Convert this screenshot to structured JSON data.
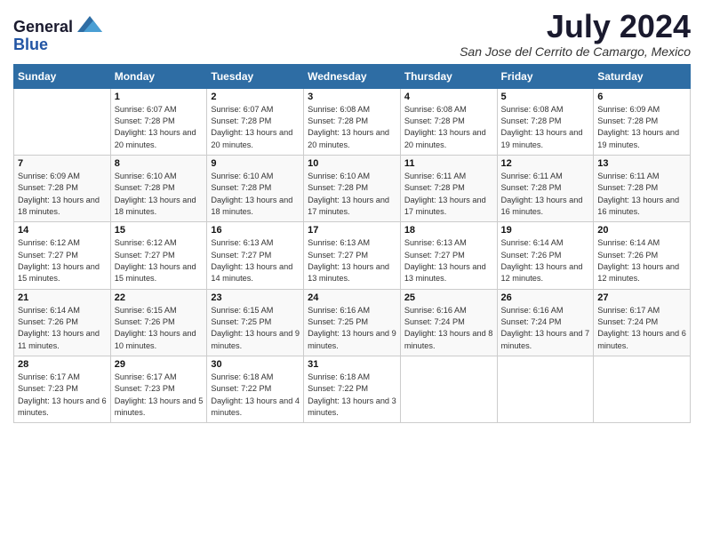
{
  "logo": {
    "general": "General",
    "blue": "Blue"
  },
  "title": "July 2024",
  "subtitle": "San Jose del Cerrito de Camargo, Mexico",
  "weekdays": [
    "Sunday",
    "Monday",
    "Tuesday",
    "Wednesday",
    "Thursday",
    "Friday",
    "Saturday"
  ],
  "weeks": [
    [
      {
        "day": "",
        "sunrise": "",
        "sunset": "",
        "daylight": ""
      },
      {
        "day": "1",
        "sunrise": "Sunrise: 6:07 AM",
        "sunset": "Sunset: 7:28 PM",
        "daylight": "Daylight: 13 hours and 20 minutes."
      },
      {
        "day": "2",
        "sunrise": "Sunrise: 6:07 AM",
        "sunset": "Sunset: 7:28 PM",
        "daylight": "Daylight: 13 hours and 20 minutes."
      },
      {
        "day": "3",
        "sunrise": "Sunrise: 6:08 AM",
        "sunset": "Sunset: 7:28 PM",
        "daylight": "Daylight: 13 hours and 20 minutes."
      },
      {
        "day": "4",
        "sunrise": "Sunrise: 6:08 AM",
        "sunset": "Sunset: 7:28 PM",
        "daylight": "Daylight: 13 hours and 20 minutes."
      },
      {
        "day": "5",
        "sunrise": "Sunrise: 6:08 AM",
        "sunset": "Sunset: 7:28 PM",
        "daylight": "Daylight: 13 hours and 19 minutes."
      },
      {
        "day": "6",
        "sunrise": "Sunrise: 6:09 AM",
        "sunset": "Sunset: 7:28 PM",
        "daylight": "Daylight: 13 hours and 19 minutes."
      }
    ],
    [
      {
        "day": "7",
        "sunrise": "Sunrise: 6:09 AM",
        "sunset": "Sunset: 7:28 PM",
        "daylight": "Daylight: 13 hours and 18 minutes."
      },
      {
        "day": "8",
        "sunrise": "Sunrise: 6:10 AM",
        "sunset": "Sunset: 7:28 PM",
        "daylight": "Daylight: 13 hours and 18 minutes."
      },
      {
        "day": "9",
        "sunrise": "Sunrise: 6:10 AM",
        "sunset": "Sunset: 7:28 PM",
        "daylight": "Daylight: 13 hours and 18 minutes."
      },
      {
        "day": "10",
        "sunrise": "Sunrise: 6:10 AM",
        "sunset": "Sunset: 7:28 PM",
        "daylight": "Daylight: 13 hours and 17 minutes."
      },
      {
        "day": "11",
        "sunrise": "Sunrise: 6:11 AM",
        "sunset": "Sunset: 7:28 PM",
        "daylight": "Daylight: 13 hours and 17 minutes."
      },
      {
        "day": "12",
        "sunrise": "Sunrise: 6:11 AM",
        "sunset": "Sunset: 7:28 PM",
        "daylight": "Daylight: 13 hours and 16 minutes."
      },
      {
        "day": "13",
        "sunrise": "Sunrise: 6:11 AM",
        "sunset": "Sunset: 7:28 PM",
        "daylight": "Daylight: 13 hours and 16 minutes."
      }
    ],
    [
      {
        "day": "14",
        "sunrise": "Sunrise: 6:12 AM",
        "sunset": "Sunset: 7:27 PM",
        "daylight": "Daylight: 13 hours and 15 minutes."
      },
      {
        "day": "15",
        "sunrise": "Sunrise: 6:12 AM",
        "sunset": "Sunset: 7:27 PM",
        "daylight": "Daylight: 13 hours and 15 minutes."
      },
      {
        "day": "16",
        "sunrise": "Sunrise: 6:13 AM",
        "sunset": "Sunset: 7:27 PM",
        "daylight": "Daylight: 13 hours and 14 minutes."
      },
      {
        "day": "17",
        "sunrise": "Sunrise: 6:13 AM",
        "sunset": "Sunset: 7:27 PM",
        "daylight": "Daylight: 13 hours and 13 minutes."
      },
      {
        "day": "18",
        "sunrise": "Sunrise: 6:13 AM",
        "sunset": "Sunset: 7:27 PM",
        "daylight": "Daylight: 13 hours and 13 minutes."
      },
      {
        "day": "19",
        "sunrise": "Sunrise: 6:14 AM",
        "sunset": "Sunset: 7:26 PM",
        "daylight": "Daylight: 13 hours and 12 minutes."
      },
      {
        "day": "20",
        "sunrise": "Sunrise: 6:14 AM",
        "sunset": "Sunset: 7:26 PM",
        "daylight": "Daylight: 13 hours and 12 minutes."
      }
    ],
    [
      {
        "day": "21",
        "sunrise": "Sunrise: 6:14 AM",
        "sunset": "Sunset: 7:26 PM",
        "daylight": "Daylight: 13 hours and 11 minutes."
      },
      {
        "day": "22",
        "sunrise": "Sunrise: 6:15 AM",
        "sunset": "Sunset: 7:26 PM",
        "daylight": "Daylight: 13 hours and 10 minutes."
      },
      {
        "day": "23",
        "sunrise": "Sunrise: 6:15 AM",
        "sunset": "Sunset: 7:25 PM",
        "daylight": "Daylight: 13 hours and 9 minutes."
      },
      {
        "day": "24",
        "sunrise": "Sunrise: 6:16 AM",
        "sunset": "Sunset: 7:25 PM",
        "daylight": "Daylight: 13 hours and 9 minutes."
      },
      {
        "day": "25",
        "sunrise": "Sunrise: 6:16 AM",
        "sunset": "Sunset: 7:24 PM",
        "daylight": "Daylight: 13 hours and 8 minutes."
      },
      {
        "day": "26",
        "sunrise": "Sunrise: 6:16 AM",
        "sunset": "Sunset: 7:24 PM",
        "daylight": "Daylight: 13 hours and 7 minutes."
      },
      {
        "day": "27",
        "sunrise": "Sunrise: 6:17 AM",
        "sunset": "Sunset: 7:24 PM",
        "daylight": "Daylight: 13 hours and 6 minutes."
      }
    ],
    [
      {
        "day": "28",
        "sunrise": "Sunrise: 6:17 AM",
        "sunset": "Sunset: 7:23 PM",
        "daylight": "Daylight: 13 hours and 6 minutes."
      },
      {
        "day": "29",
        "sunrise": "Sunrise: 6:17 AM",
        "sunset": "Sunset: 7:23 PM",
        "daylight": "Daylight: 13 hours and 5 minutes."
      },
      {
        "day": "30",
        "sunrise": "Sunrise: 6:18 AM",
        "sunset": "Sunset: 7:22 PM",
        "daylight": "Daylight: 13 hours and 4 minutes."
      },
      {
        "day": "31",
        "sunrise": "Sunrise: 6:18 AM",
        "sunset": "Sunset: 7:22 PM",
        "daylight": "Daylight: 13 hours and 3 minutes."
      },
      {
        "day": "",
        "sunrise": "",
        "sunset": "",
        "daylight": ""
      },
      {
        "day": "",
        "sunrise": "",
        "sunset": "",
        "daylight": ""
      },
      {
        "day": "",
        "sunrise": "",
        "sunset": "",
        "daylight": ""
      }
    ]
  ]
}
